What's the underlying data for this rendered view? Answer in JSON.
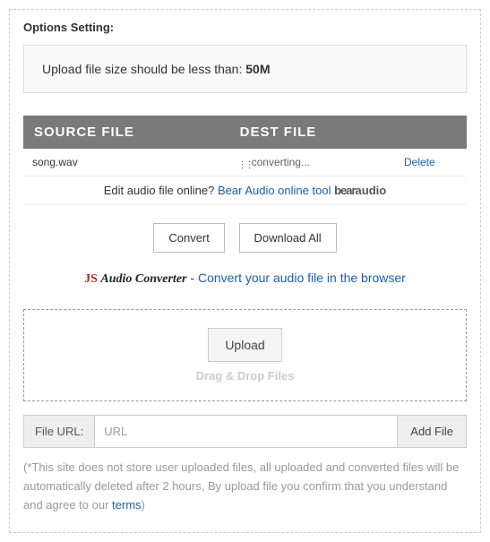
{
  "section_title": "Options Setting:",
  "notice": {
    "prefix": "Upload file size should be less than: ",
    "limit": "50M"
  },
  "table": {
    "headers": [
      "SOURCE FILE",
      "DEST FILE",
      ""
    ],
    "rows": [
      {
        "source": "song.wav",
        "dest": "converting...",
        "action": "Delete"
      }
    ]
  },
  "edit_row": {
    "prefix": "Edit audio file online? ",
    "link": "Bear Audio online tool",
    "logo_a": "bear",
    "logo_b": "audio"
  },
  "buttons": {
    "convert": "Convert",
    "download_all": "Download All"
  },
  "js_row": {
    "logo_a": "JS",
    "logo_b": "Audio Converter",
    "sep": " - ",
    "link": "Convert your audio file in the browser"
  },
  "upload": {
    "button": "Upload",
    "drag": "Drag & Drop Files"
  },
  "url_row": {
    "label": "File URL:",
    "placeholder": "URL",
    "add": "Add File"
  },
  "disclaimer": {
    "text1": "(*This site does not store user uploaded files, all uploaded and converted files will be automatically deleted after 2 hours, By upload file you confirm that you understand and agree to our ",
    "terms": "terms",
    "text2": ")"
  }
}
